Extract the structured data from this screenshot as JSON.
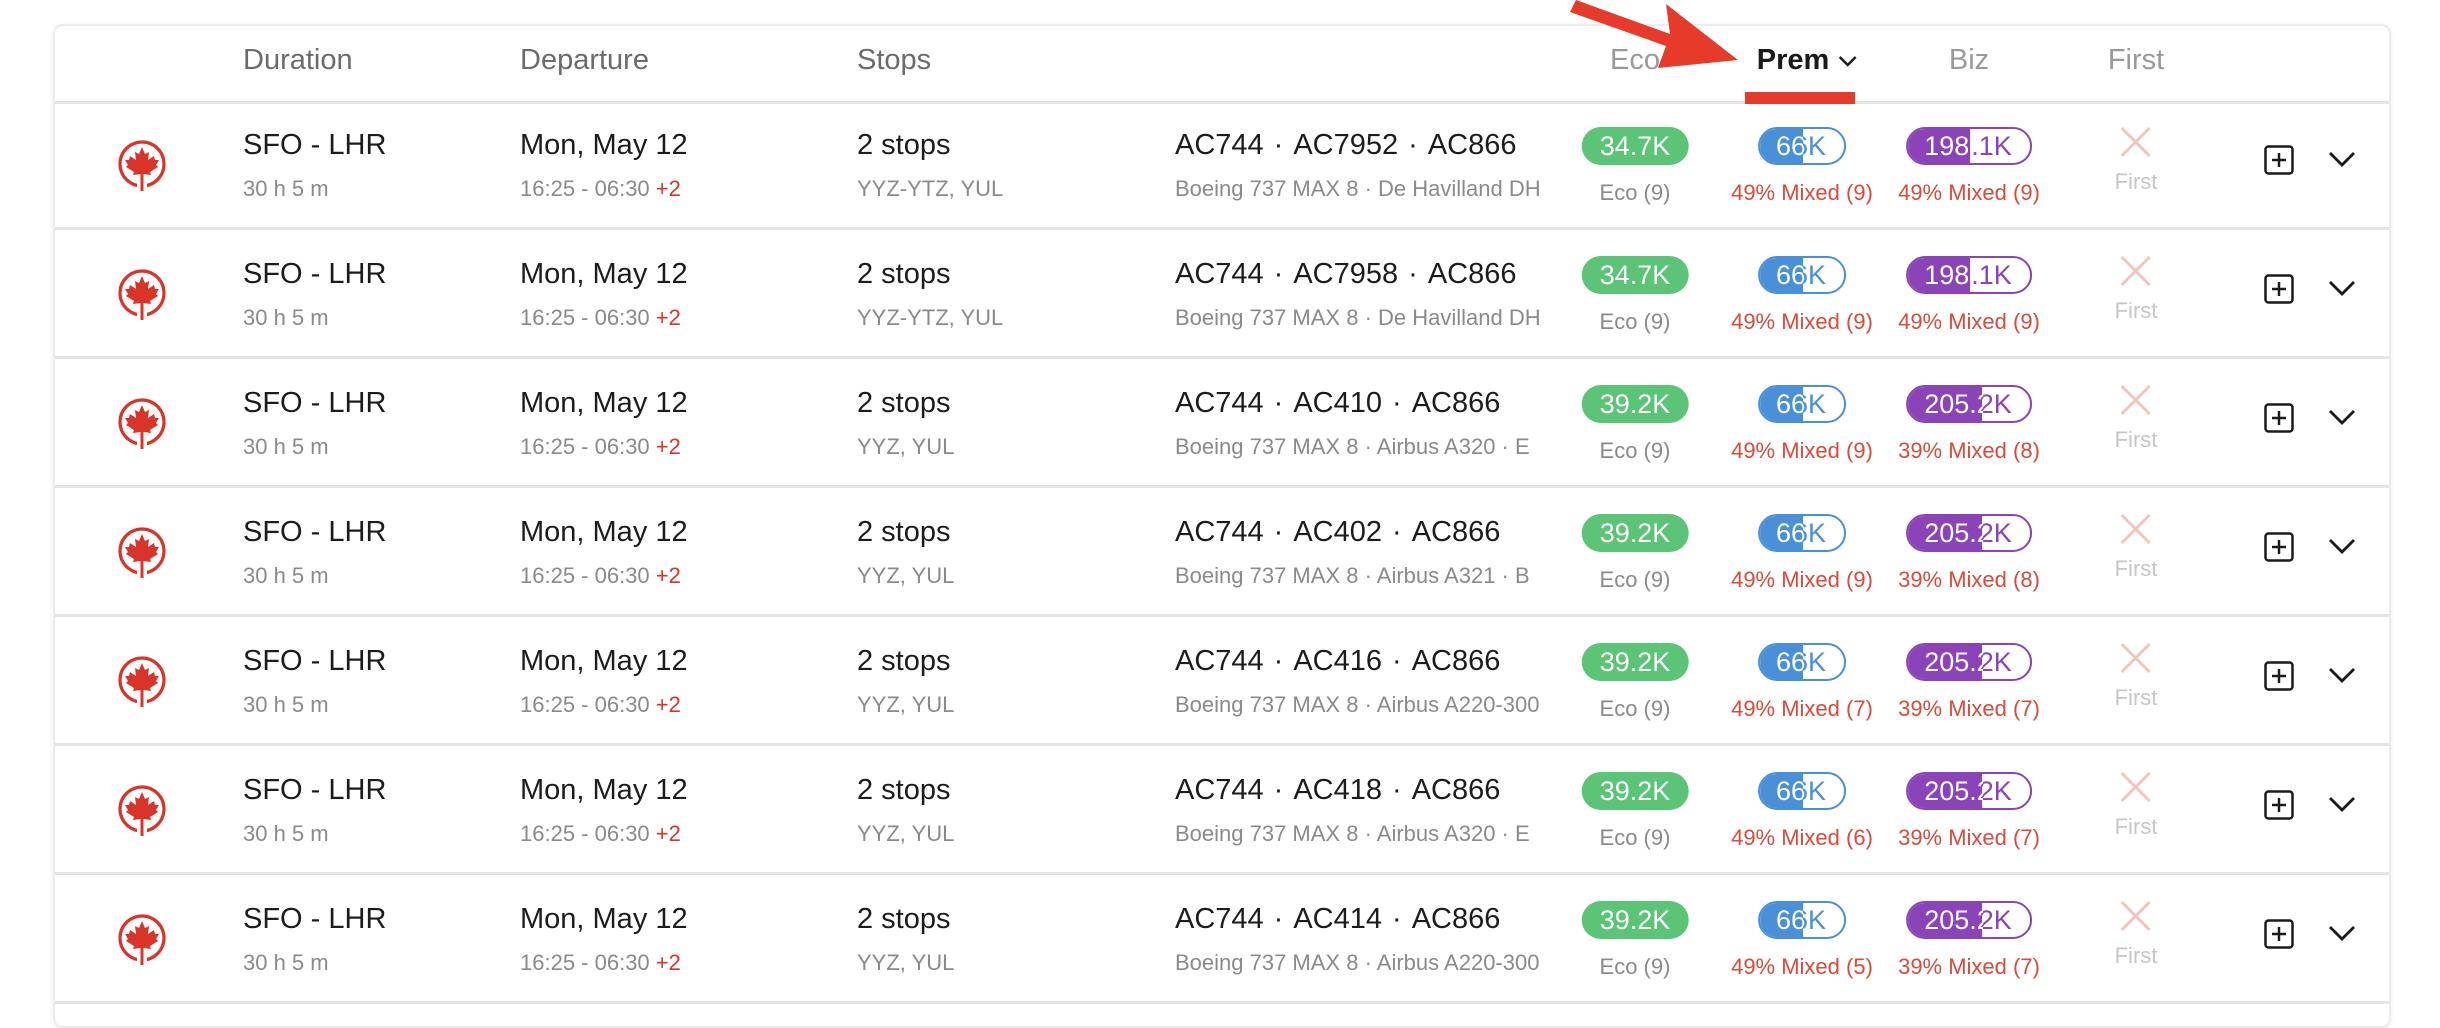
{
  "header": {
    "columns": {
      "duration": "Duration",
      "departure": "Departure",
      "stops": "Stops",
      "eco": "Eco",
      "prem": "Prem",
      "biz": "Biz",
      "first": "First"
    },
    "sorted_by": "Prem",
    "sort_icon": "chevron-down-icon"
  },
  "colors": {
    "eco": "#5cc476",
    "prem": "#4a90d9",
    "biz": "#8b43b8",
    "accent": "#e63b2a",
    "mixed_text": "#d84a3a"
  },
  "rows": [
    {
      "airline_logo": "air-canada-maple-leaf-icon",
      "route": "SFO - LHR",
      "duration": "30 h 5 m",
      "date": "Mon, May 12",
      "times": "16:25 - 06:30",
      "day_offset": "+2",
      "stops": "2 stops",
      "via": "YYZ-YTZ, YUL",
      "flights": [
        "AC744",
        "AC7952",
        "AC866"
      ],
      "aircraft": "Boeing 737 MAX 8  ·  De Havilland DH",
      "eco": {
        "price": "34.7K",
        "label": "Eco (9)"
      },
      "prem": {
        "price": "66K",
        "label": "49% Mixed (9)",
        "mixed_pct": 49
      },
      "biz": {
        "price": "198.1K",
        "label": "49% Mixed (9)",
        "mixed_pct": 49
      },
      "first": {
        "available": false,
        "label": "First"
      }
    },
    {
      "airline_logo": "air-canada-maple-leaf-icon",
      "route": "SFO - LHR",
      "duration": "30 h 5 m",
      "date": "Mon, May 12",
      "times": "16:25 - 06:30",
      "day_offset": "+2",
      "stops": "2 stops",
      "via": "YYZ-YTZ, YUL",
      "flights": [
        "AC744",
        "AC7958",
        "AC866"
      ],
      "aircraft": "Boeing 737 MAX 8  ·  De Havilland DH",
      "eco": {
        "price": "34.7K",
        "label": "Eco (9)"
      },
      "prem": {
        "price": "66K",
        "label": "49% Mixed (9)",
        "mixed_pct": 49
      },
      "biz": {
        "price": "198.1K",
        "label": "49% Mixed (9)",
        "mixed_pct": 49
      },
      "first": {
        "available": false,
        "label": "First"
      }
    },
    {
      "airline_logo": "air-canada-maple-leaf-icon",
      "route": "SFO - LHR",
      "duration": "30 h 5 m",
      "date": "Mon, May 12",
      "times": "16:25 - 06:30",
      "day_offset": "+2",
      "stops": "2 stops",
      "via": "YYZ, YUL",
      "flights": [
        "AC744",
        "AC410",
        "AC866"
      ],
      "aircraft": "Boeing 737 MAX 8  ·  Airbus A320  ·  E",
      "eco": {
        "price": "39.2K",
        "label": "Eco (9)"
      },
      "prem": {
        "price": "66K",
        "label": "49% Mixed (9)",
        "mixed_pct": 49
      },
      "biz": {
        "price": "205.2K",
        "label": "39% Mixed (8)",
        "mixed_pct": 39
      },
      "first": {
        "available": false,
        "label": "First"
      }
    },
    {
      "airline_logo": "air-canada-maple-leaf-icon",
      "route": "SFO - LHR",
      "duration": "30 h 5 m",
      "date": "Mon, May 12",
      "times": "16:25 - 06:30",
      "day_offset": "+2",
      "stops": "2 stops",
      "via": "YYZ, YUL",
      "flights": [
        "AC744",
        "AC402",
        "AC866"
      ],
      "aircraft": "Boeing 737 MAX 8  ·  Airbus A321  ·  B",
      "eco": {
        "price": "39.2K",
        "label": "Eco (9)"
      },
      "prem": {
        "price": "66K",
        "label": "49% Mixed (9)",
        "mixed_pct": 49
      },
      "biz": {
        "price": "205.2K",
        "label": "39% Mixed (8)",
        "mixed_pct": 39
      },
      "first": {
        "available": false,
        "label": "First"
      }
    },
    {
      "airline_logo": "air-canada-maple-leaf-icon",
      "route": "SFO - LHR",
      "duration": "30 h 5 m",
      "date": "Mon, May 12",
      "times": "16:25 - 06:30",
      "day_offset": "+2",
      "stops": "2 stops",
      "via": "YYZ, YUL",
      "flights": [
        "AC744",
        "AC416",
        "AC866"
      ],
      "aircraft": "Boeing 737 MAX 8  ·  Airbus A220-300",
      "eco": {
        "price": "39.2K",
        "label": "Eco (9)"
      },
      "prem": {
        "price": "66K",
        "label": "49% Mixed (7)",
        "mixed_pct": 49
      },
      "biz": {
        "price": "205.2K",
        "label": "39% Mixed (7)",
        "mixed_pct": 39
      },
      "first": {
        "available": false,
        "label": "First"
      }
    },
    {
      "airline_logo": "air-canada-maple-leaf-icon",
      "route": "SFO - LHR",
      "duration": "30 h 5 m",
      "date": "Mon, May 12",
      "times": "16:25 - 06:30",
      "day_offset": "+2",
      "stops": "2 stops",
      "via": "YYZ, YUL",
      "flights": [
        "AC744",
        "AC418",
        "AC866"
      ],
      "aircraft": "Boeing 737 MAX 8  ·  Airbus A320  ·  E",
      "eco": {
        "price": "39.2K",
        "label": "Eco (9)"
      },
      "prem": {
        "price": "66K",
        "label": "49% Mixed (6)",
        "mixed_pct": 49
      },
      "biz": {
        "price": "205.2K",
        "label": "39% Mixed (7)",
        "mixed_pct": 39
      },
      "first": {
        "available": false,
        "label": "First"
      }
    },
    {
      "airline_logo": "air-canada-maple-leaf-icon",
      "route": "SFO - LHR",
      "duration": "30 h 5 m",
      "date": "Mon, May 12",
      "times": "16:25 - 06:30",
      "day_offset": "+2",
      "stops": "2 stops",
      "via": "YYZ, YUL",
      "flights": [
        "AC744",
        "AC414",
        "AC866"
      ],
      "aircraft": "Boeing 737 MAX 8  ·  Airbus A220-300",
      "eco": {
        "price": "39.2K",
        "label": "Eco (9)"
      },
      "prem": {
        "price": "66K",
        "label": "49% Mixed (5)",
        "mixed_pct": 49
      },
      "biz": {
        "price": "205.2K",
        "label": "39% Mixed (7)",
        "mixed_pct": 39
      },
      "first": {
        "available": false,
        "label": "First"
      }
    }
  ],
  "annotation": {
    "type": "arrow",
    "points_to": "Prem"
  }
}
